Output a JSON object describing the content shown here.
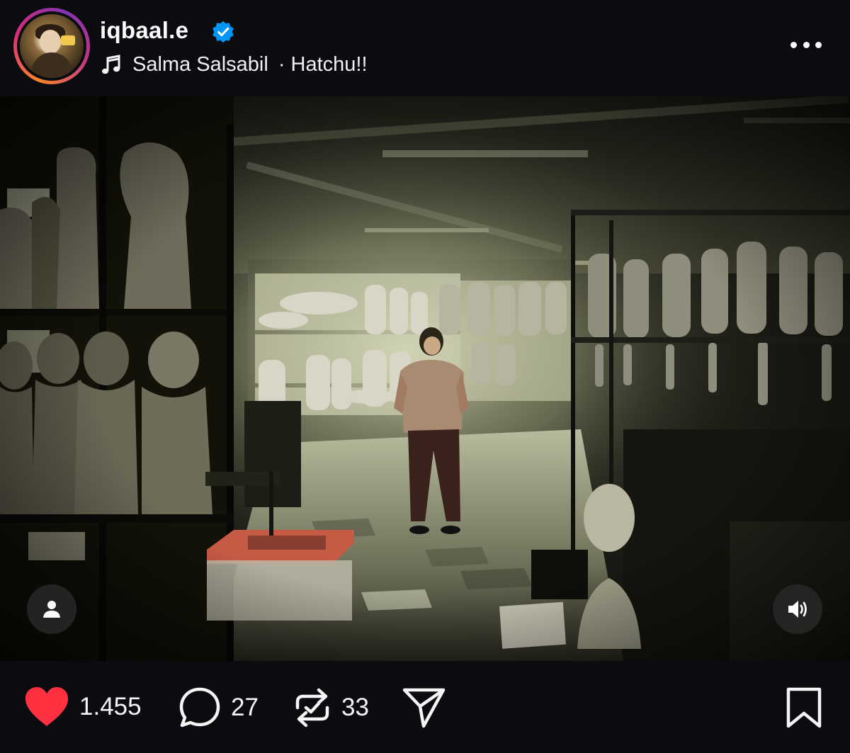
{
  "header": {
    "username": "iqbaal.e",
    "verified": true,
    "music": {
      "artist": "Salma Salsabil",
      "separator": "·",
      "track": "Hatchu!!"
    }
  },
  "post": {
    "image_subject": "dim warehouse filled with mannequin torsos on metal shelves, a person standing in the center aisle",
    "has_user_tags": true,
    "audio": "on"
  },
  "actions": {
    "likes": "1.455",
    "comments": "27",
    "reposts": "33",
    "liked": true
  },
  "colors": {
    "background": "#0b0c10",
    "like_red": "#ff3040",
    "verified_blue": "#0095f6",
    "text": "#f5f5f5"
  },
  "icons": [
    "music-note-icon",
    "verified-badge-icon",
    "more-icon",
    "user-tag-icon",
    "speaker-icon",
    "heart-icon",
    "comment-icon",
    "repost-icon",
    "share-icon",
    "bookmark-icon"
  ]
}
